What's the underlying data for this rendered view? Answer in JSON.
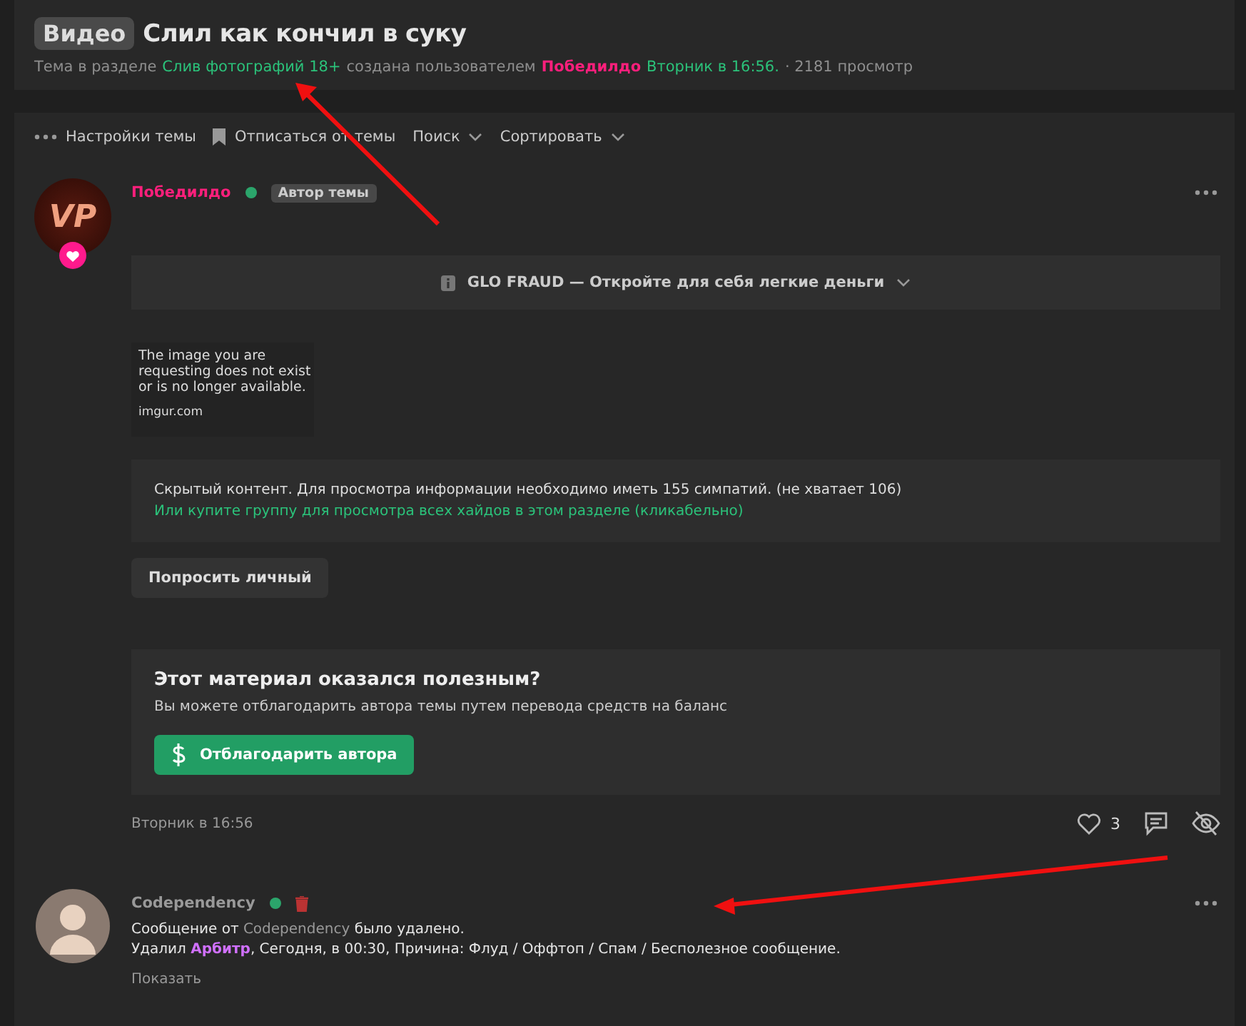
{
  "thread": {
    "prefix": "Видео",
    "title": "Слил как кончил в суку",
    "meta": {
      "lead": "Тема в разделе",
      "forum": "Слив фотографий 18+",
      "middle": "создана пользователем",
      "author": "Победилдо",
      "date": "Вторник в 16:56.",
      "views": "· 2181 просмотр"
    }
  },
  "toolbar": [
    {
      "kind": "dots",
      "label": "Настройки темы"
    },
    {
      "kind": "bookmark",
      "label": "Отписаться от темы"
    },
    {
      "kind": "dropdown",
      "label": "Поиск"
    },
    {
      "kind": "dropdown",
      "label": "Сортировать"
    }
  ],
  "post": {
    "avatar": "VP",
    "author": "Победилдо",
    "online": true,
    "badge": "Автор темы",
    "ad": "GLO FRAUD — Откройте для себя легкие деньги",
    "image_text": [
      "The image you are",
      "requesting does not exist",
      "or is no longer available.",
      "imgur.com"
    ],
    "hidden": {
      "text": "Скрытый контент. Для просмотра информации необходимо иметь 155 симпатий. (не хватает 106)",
      "link": "Или купите группу для просмотра всех хайдов в этом разделе (кликабельно)"
    },
    "request_button": "Попросить личный",
    "thanks": {
      "title": "Этот материал оказался полезным?",
      "text": "Вы можете отблагодарить автора темы путем перевода средств на баланс",
      "button": "Отблагодарить автора"
    },
    "date": "Вторник в 16:56",
    "likes": "3"
  },
  "deleted_post": {
    "author": "Codependency",
    "online": true,
    "line1": {
      "before": "Сообщение от",
      "user": "Codependency",
      "after": "было удалено."
    },
    "line2": {
      "before": "Удалил",
      "moderator": "Арбитр",
      "after": ", Сегодня, в 00:30, Причина: Флуд / Оффтоп / Спам / Бесполезное сообщение."
    },
    "show": "Показать"
  }
}
